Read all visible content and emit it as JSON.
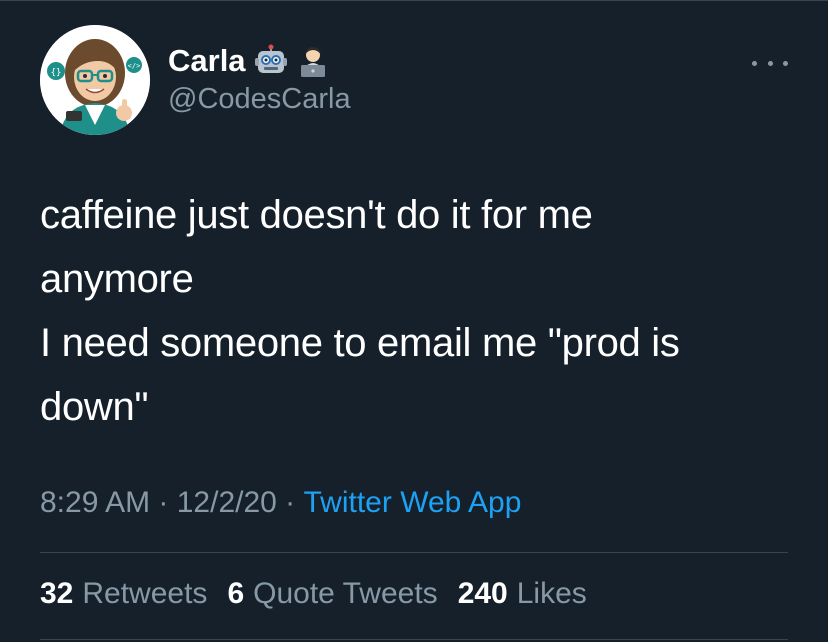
{
  "user": {
    "display_name": "Carla",
    "handle": "@CodesCarla",
    "name_emojis": [
      "robot-face-emoji",
      "technologist-emoji"
    ]
  },
  "tweet": {
    "text": "caffeine just doesn't do it for me\nanymore\nI need someone to email me \"prod is\ndown\"",
    "time": "8:29 AM",
    "date": "12/2/20",
    "separator": " · ",
    "source": "Twitter Web App"
  },
  "stats": {
    "retweets_count": "32",
    "retweets_label": "Retweets",
    "quotes_count": "6",
    "quotes_label": "Quote Tweets",
    "likes_count": "240",
    "likes_label": "Likes"
  },
  "colors": {
    "background": "#15202b",
    "primary_text": "#ffffff",
    "secondary_text": "#8899a6",
    "link": "#1da1f2",
    "divider": "#38444d"
  }
}
